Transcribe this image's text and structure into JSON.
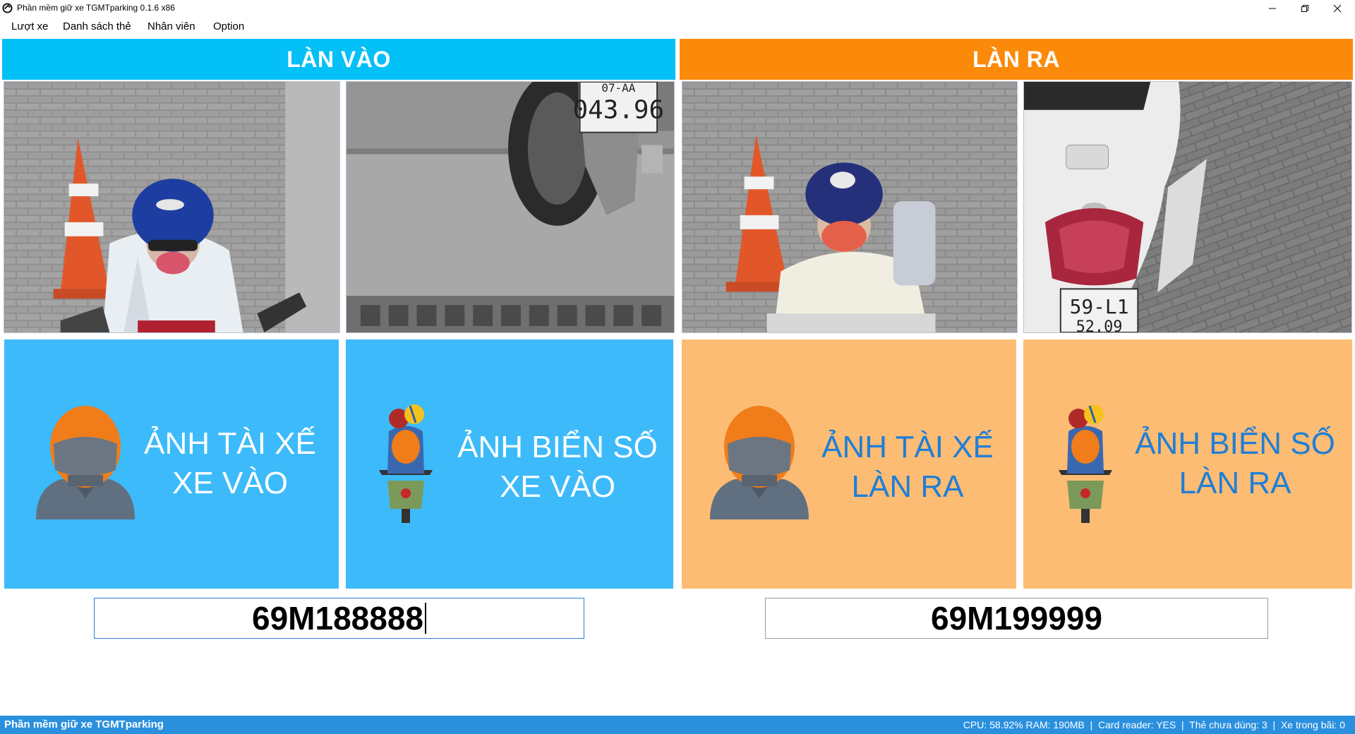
{
  "window": {
    "title": "Phần mềm giữ xe TGMTparking 0.1.6 x86"
  },
  "menu": {
    "items": [
      "Lượt xe",
      "Danh sách thẻ",
      "Nhân viên",
      "Option"
    ]
  },
  "lane_in": {
    "header": "LÀN VÀO",
    "driver_panel": {
      "line1": "ẢNH TÀI XẾ",
      "line2": "XE VÀO"
    },
    "plate_panel": {
      "line1": "ẢNH BIỂN SỐ",
      "line2": "XE VÀO"
    },
    "plate_value": "69M188888",
    "plate_image_text": [
      "07-AA",
      "043.96"
    ]
  },
  "lane_out": {
    "header": "LÀN RA",
    "driver_panel": {
      "line1": "ẢNH TÀI XẾ",
      "line2": "LÀN RA"
    },
    "plate_panel": {
      "line1": "ẢNH BIỂN SỐ",
      "line2": "LÀN RA"
    },
    "plate_value": "69M199999",
    "plate_image_text": [
      "59-L1",
      "52.09"
    ]
  },
  "statusbar": {
    "app_name": "Phần mềm giữ xe TGMTparking",
    "cpu_ram": "CPU: 58.92% RAM: 190MB",
    "card_reader": "Card reader: YES",
    "unused_cards": "Thẻ chưa dùng: 3",
    "vehicles_in_lot": "Xe trong bãi: 0",
    "separator": "|"
  },
  "colors": {
    "lane_in_header": "#03c0f7",
    "lane_out_header": "#fb8a0a",
    "lane_in_panel": "#3dbafa",
    "lane_out_panel": "#fdbc74",
    "lane_out_panel_text": "#1f7fd6",
    "statusbar": "#2a90de"
  },
  "icons": {
    "app": "app-logo-icon",
    "minimize": "minimize-icon",
    "maximize": "restore-icon",
    "close": "close-icon",
    "driver": "helmet-driver-icon",
    "plate": "motorbike-rider-icon"
  }
}
